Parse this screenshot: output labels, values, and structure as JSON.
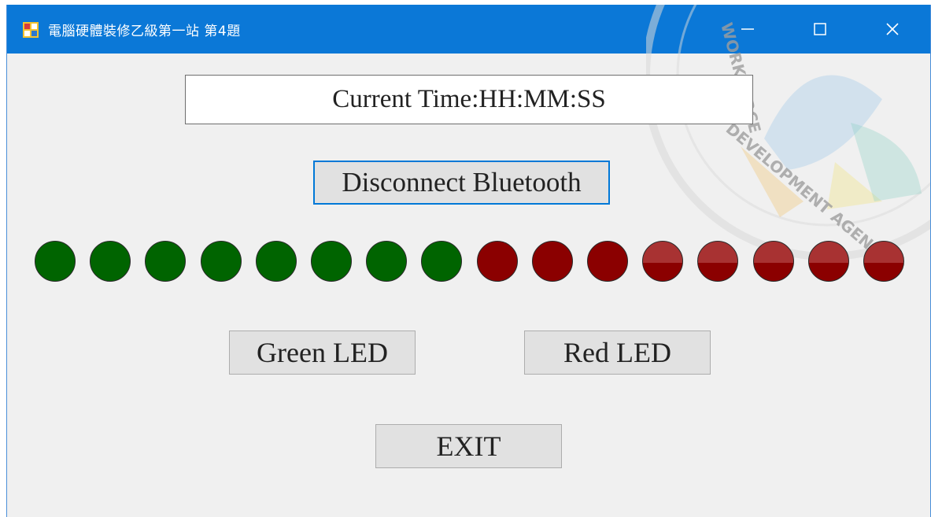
{
  "window": {
    "title": "電腦硬體裝修乙級第一站 第4題",
    "controls": {
      "minimize": "—",
      "maximize": "☐",
      "close": "✕"
    }
  },
  "time_display": {
    "text": "Current Time:HH:MM:SS"
  },
  "buttons": {
    "bluetooth": "Disconnect Bluetooth",
    "green_led": "Green LED",
    "red_led": "Red LED",
    "exit": "EXIT"
  },
  "leds": [
    {
      "color": "green"
    },
    {
      "color": "green"
    },
    {
      "color": "green"
    },
    {
      "color": "green"
    },
    {
      "color": "green"
    },
    {
      "color": "green"
    },
    {
      "color": "green"
    },
    {
      "color": "green"
    },
    {
      "color": "red"
    },
    {
      "color": "red"
    },
    {
      "color": "red"
    },
    {
      "color": "red"
    },
    {
      "color": "red"
    },
    {
      "color": "red"
    },
    {
      "color": "red"
    },
    {
      "color": "red"
    }
  ],
  "colors": {
    "titlebar": "#0b78d7",
    "led_green": "#006400",
    "led_red": "#8b0000",
    "led_red_overlay": "#a83232",
    "focus_border": "#0078d7"
  },
  "icons": {
    "app": "app-form-icon",
    "minimize": "minimize-icon",
    "maximize": "maximize-icon",
    "close": "close-icon"
  }
}
